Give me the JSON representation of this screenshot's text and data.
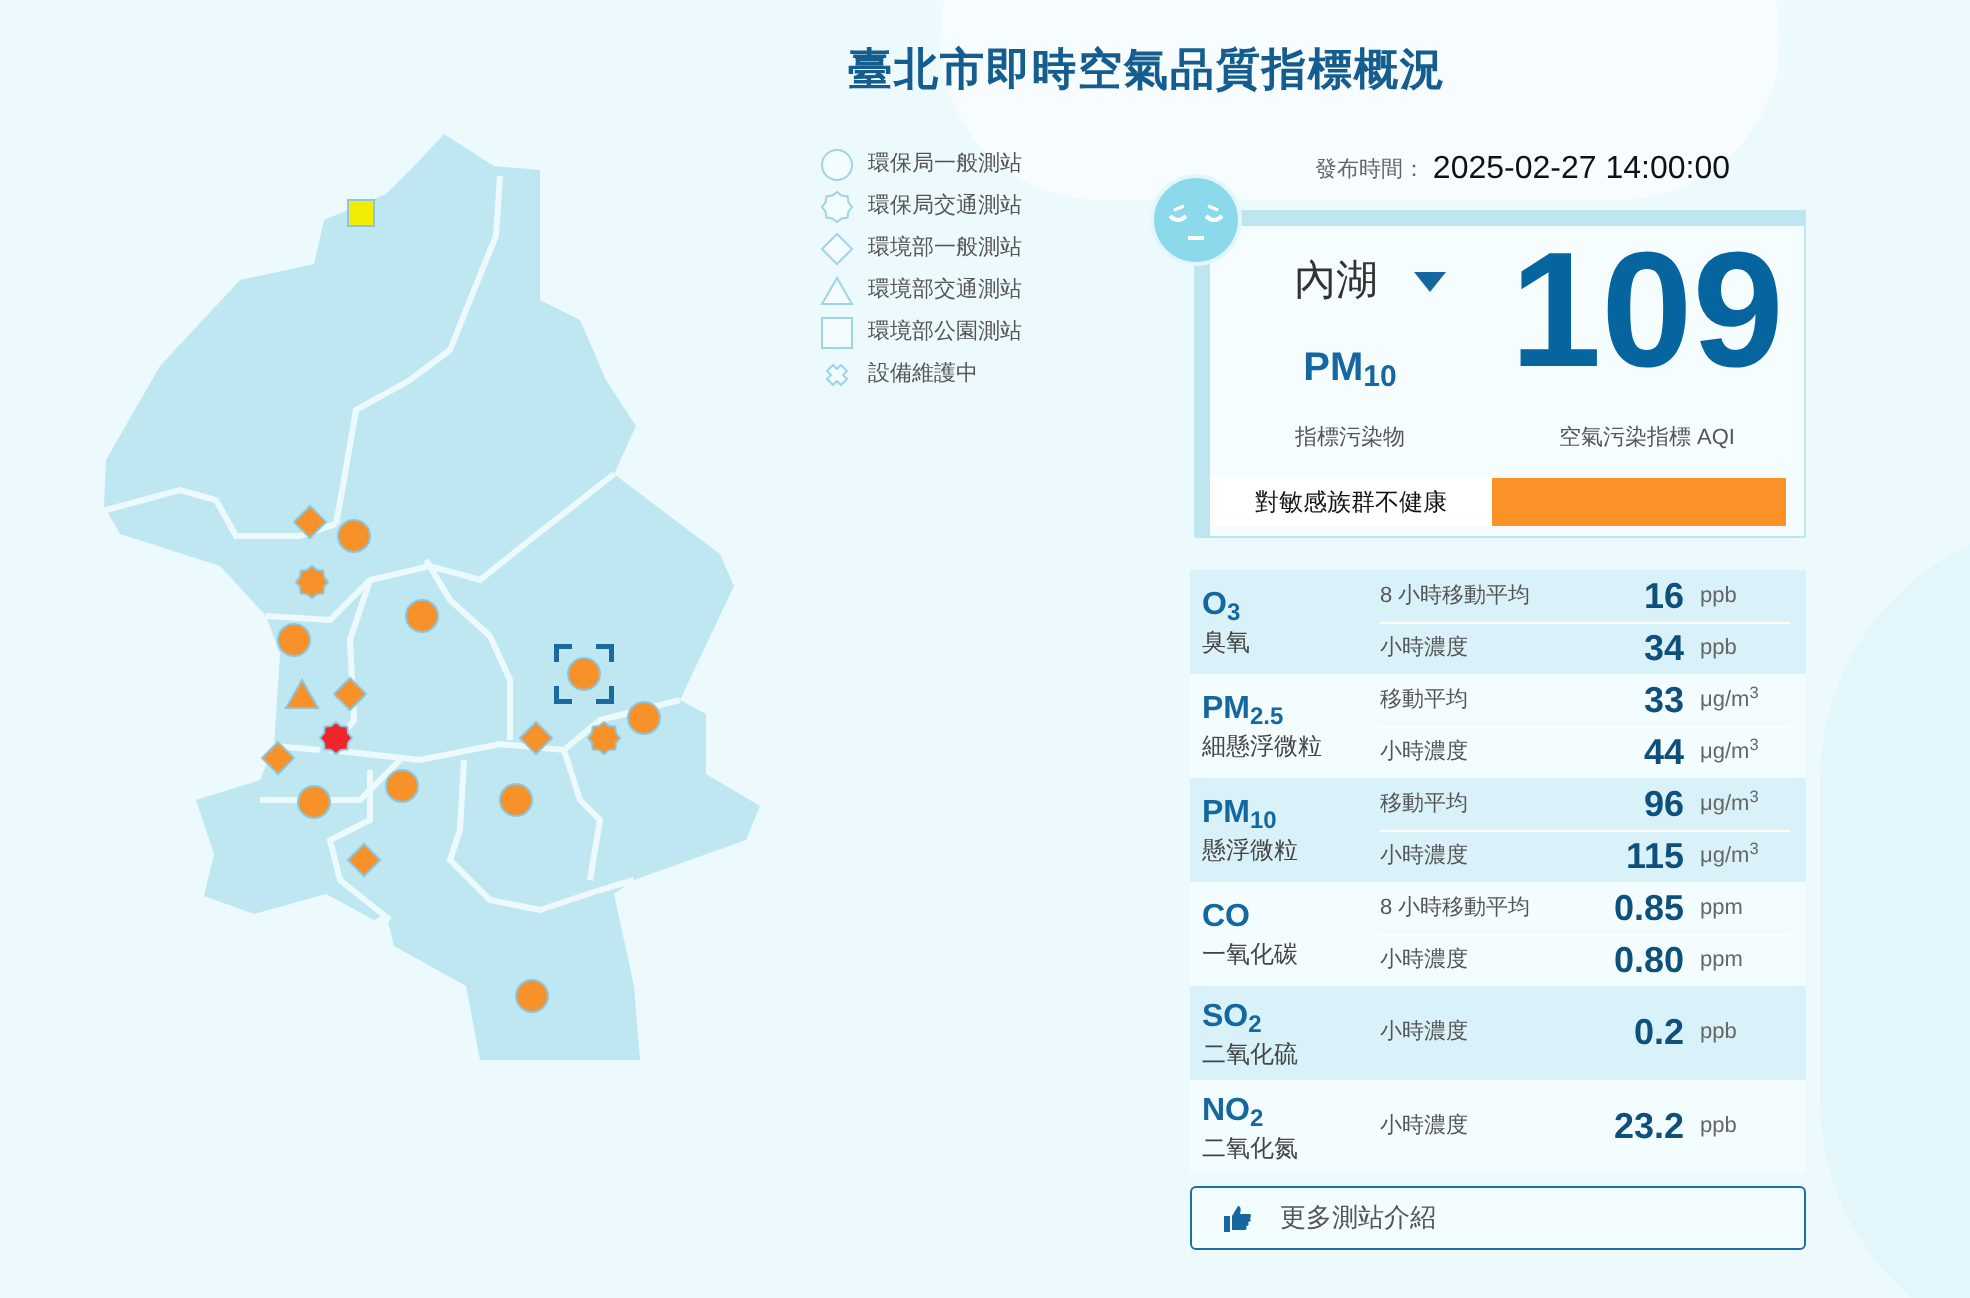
{
  "title": "臺北市即時空氣品質指標概況",
  "legend": [
    {
      "kind": "circle",
      "label": "環保局一般測站"
    },
    {
      "kind": "star",
      "label": "環保局交通測站"
    },
    {
      "kind": "diamond",
      "label": "環境部一般測站"
    },
    {
      "kind": "triangle",
      "label": "環境部交通測站"
    },
    {
      "kind": "square",
      "label": "環境部公園測站"
    },
    {
      "kind": "cross",
      "label": "設備維護中"
    }
  ],
  "stations": [
    {
      "kind": "square",
      "color": "#f2ec05",
      "selected": false
    },
    {
      "kind": "diamond",
      "color": "#f7922a",
      "selected": false
    },
    {
      "kind": "circle",
      "color": "#f7922a",
      "selected": false
    },
    {
      "kind": "star",
      "color": "#f7922a",
      "selected": false
    },
    {
      "kind": "circle",
      "color": "#f7922a",
      "selected": false
    },
    {
      "kind": "circle",
      "color": "#f7922a",
      "selected": false
    },
    {
      "kind": "triangle",
      "color": "#f7922a",
      "selected": false
    },
    {
      "kind": "diamond",
      "color": "#f7922a",
      "selected": false
    },
    {
      "kind": "star",
      "color": "#f0262f",
      "selected": false
    },
    {
      "kind": "diamond",
      "color": "#f7922a",
      "selected": false
    },
    {
      "kind": "circle",
      "color": "#f7922a",
      "selected": false
    },
    {
      "kind": "circle",
      "color": "#f7922a",
      "selected": false
    },
    {
      "kind": "circle",
      "color": "#f7922a",
      "selected": true
    },
    {
      "kind": "diamond",
      "color": "#f7922a",
      "selected": false
    },
    {
      "kind": "star",
      "color": "#f7922a",
      "selected": false
    },
    {
      "kind": "circle",
      "color": "#f7922a",
      "selected": false
    },
    {
      "kind": "circle",
      "color": "#f7922a",
      "selected": false
    },
    {
      "kind": "diamond",
      "color": "#f7922a",
      "selected": false
    },
    {
      "kind": "circle",
      "color": "#f7922a",
      "selected": false
    }
  ],
  "publish": {
    "label": "發布時間：",
    "time": "2025-02-27 14:00:00"
  },
  "station_select": {
    "name": "內湖"
  },
  "aqi": {
    "pollutant": "PM$_{10}$",
    "pollutant_label": "指標污染物",
    "value": "109",
    "value_label": "空氣污染指標 AQI"
  },
  "status": {
    "text": "對敏感族群不健康",
    "color": "#fb9227"
  },
  "pollutants": [
    {
      "name": "O$_{3}$",
      "chinese": "臭氧",
      "readings": [
        {
          "label": "8 小時移動平均",
          "value": "16",
          "unit": "ppb"
        },
        {
          "label": "小時濃度",
          "value": "34",
          "unit": "ppb"
        }
      ]
    },
    {
      "name": "PM$_{2.5}$",
      "chinese": "細懸浮微粒",
      "readings": [
        {
          "label": "移動平均",
          "value": "33",
          "unit": "μg/m$^{3}$"
        },
        {
          "label": "小時濃度",
          "value": "44",
          "unit": "μg/m$^{3}$"
        }
      ]
    },
    {
      "name": "PM$_{10}$",
      "chinese": "懸浮微粒",
      "readings": [
        {
          "label": "移動平均",
          "value": "96",
          "unit": "μg/m$^{3}$"
        },
        {
          "label": "小時濃度",
          "value": "115",
          "unit": "μg/m$^{3}$"
        }
      ]
    },
    {
      "name": "CO",
      "chinese": "一氧化碳",
      "readings": [
        {
          "label": "8 小時移動平均",
          "value": "0.85",
          "unit": "ppm"
        },
        {
          "label": "小時濃度",
          "value": "0.80",
          "unit": "ppm"
        }
      ]
    },
    {
      "name": "SO$_{2}$",
      "chinese": "二氧化硫",
      "readings": [
        {
          "label": "小時濃度",
          "value": "0.2",
          "unit": "ppb"
        }
      ]
    },
    {
      "name": "NO$_{2}$",
      "chinese": "二氧化氮",
      "readings": [
        {
          "label": "小時濃度",
          "value": "23.2",
          "unit": "ppb"
        }
      ]
    }
  ],
  "more_button": {
    "label": "更多測站介紹"
  }
}
